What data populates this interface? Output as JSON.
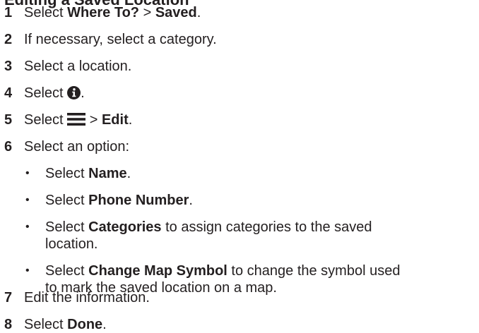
{
  "heading": "Editing a Saved Location",
  "steps": [
    {
      "num": "1",
      "pre": "Select ",
      "b1": "Where To?",
      "mid": " > ",
      "b2": "Saved",
      "post": "."
    },
    {
      "num": "2",
      "text": "If necessary, select a category."
    },
    {
      "num": "3",
      "text": "Select a location."
    },
    {
      "num": "4",
      "pre": "Select ",
      "icon": "info-circle-icon",
      "post": "."
    },
    {
      "num": "5",
      "pre": "Select ",
      "icon": "menu-hamburger-icon",
      "mid": " > ",
      "b1": "Edit",
      "post": "."
    },
    {
      "num": "6",
      "text": "Select an option:"
    },
    {
      "num": "7",
      "text": "Edit the information."
    },
    {
      "num": "8",
      "pre": "Select ",
      "b1": "Done",
      "post": "."
    }
  ],
  "options": [
    {
      "pre": "Select ",
      "b": "Name",
      "post": "."
    },
    {
      "pre": "Select ",
      "b": "Phone Number",
      "post": "."
    },
    {
      "pre": "Select ",
      "b": "Categories",
      "post": " to assign categories to the saved",
      "line2": "location."
    },
    {
      "pre": "Select ",
      "b": "Change Map Symbol",
      "post": " to change the symbol used",
      "line2": "to mark the saved location on a map."
    }
  ]
}
